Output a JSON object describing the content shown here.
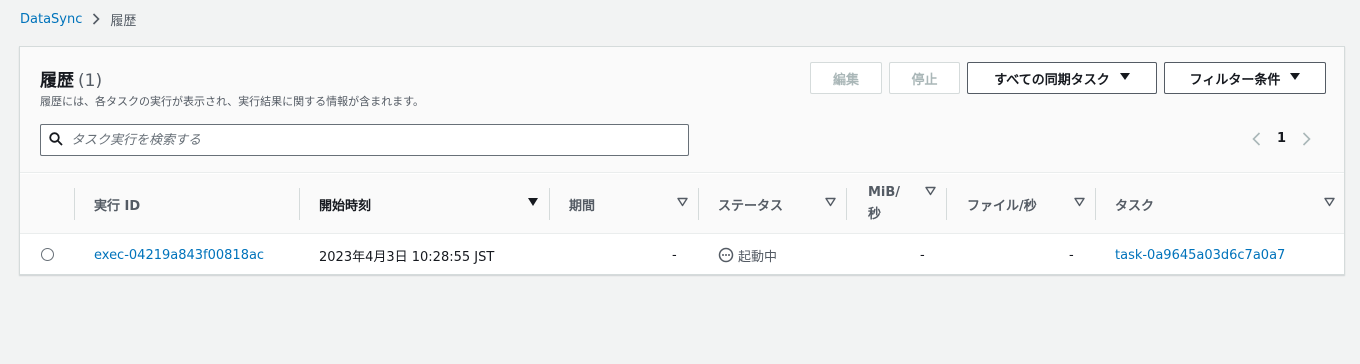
{
  "breadcrumb": {
    "root": "DataSync",
    "current": "履歴"
  },
  "panel": {
    "title": "履歴",
    "count": "(1)",
    "description": "履歴には、各タスクの実行が表示され、実行結果に関する情報が含まれます。",
    "buttons": {
      "edit": "編集",
      "stop": "停止",
      "task_filter": "すべての同期タスク",
      "filter_conditions": "フィルター条件"
    },
    "search": {
      "placeholder": "タスク実行を検索する",
      "value": ""
    },
    "pagination": {
      "current_page": "1"
    }
  },
  "table": {
    "columns": {
      "exec_id": "実行 ID",
      "start_time": "開始時刻",
      "duration": "期間",
      "status": "ステータス",
      "mib_line1": "MiB/",
      "mib_line2": "秒",
      "files": "ファイル/秒",
      "task": "タスク"
    },
    "rows": [
      {
        "exec_id": "exec-04219a843f00818ac",
        "start_time": "2023年4月3日 10:28:55 JST",
        "duration": "-",
        "status": "起動中",
        "mib_per_sec": "-",
        "files_per_sec": "-",
        "task": "task-0a9645a03d6c7a0a7"
      }
    ]
  },
  "colors": {
    "link": "#0073bb",
    "text": "#16191f",
    "muted": "#545b64",
    "border": "#d5dbdb",
    "background": "#f2f3f3"
  }
}
